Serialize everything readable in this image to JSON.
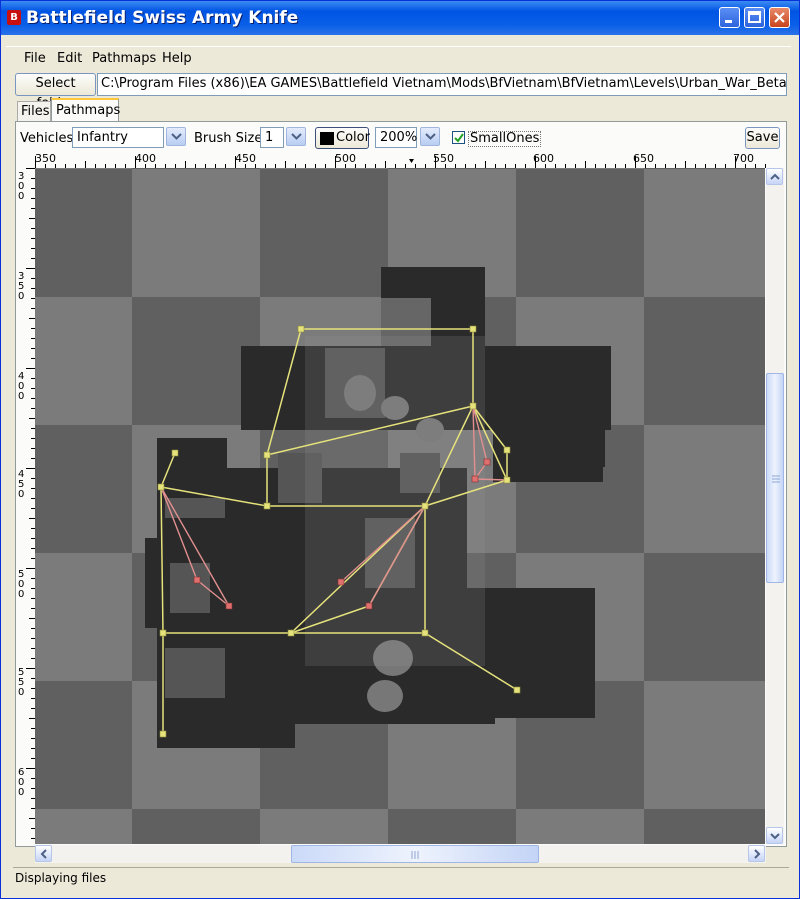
{
  "window": {
    "title": "Battlefield Swiss Army Knife",
    "icon_letter": "B"
  },
  "menu": {
    "items": [
      "File",
      "Edit",
      "Pathmaps",
      "Help"
    ]
  },
  "folder": {
    "button_label": "Select folder",
    "path": "C:\\Program Files (x86)\\EA GAMES\\Battlefield Vietnam\\Mods\\BfVietnam\\BfVietnam\\Levels\\Urban_War_BetaA"
  },
  "tabs": [
    {
      "label": "Files"
    },
    {
      "label": "Pathmaps"
    }
  ],
  "toolbar": {
    "vehicles_label": "Vehicles",
    "vehicles_value": "Infantry",
    "brush_label": "Brush Size",
    "brush_value": "1",
    "color_label": "Color",
    "zoom_value": "200%",
    "smallones_label": "SmallOnes",
    "smallones_checked": true,
    "save_label": "Save"
  },
  "rulers": {
    "top": [
      "350",
      "400",
      "450",
      "500",
      "550",
      "600",
      "650",
      "700"
    ],
    "left": [
      "300",
      "350",
      "400",
      "450",
      "500",
      "550",
      "600"
    ]
  },
  "colors": {
    "path_line": "#e4e080",
    "path_alt": "#e08a8a",
    "title_blue": "#0054e3"
  },
  "status": {
    "text": "Displaying files"
  }
}
